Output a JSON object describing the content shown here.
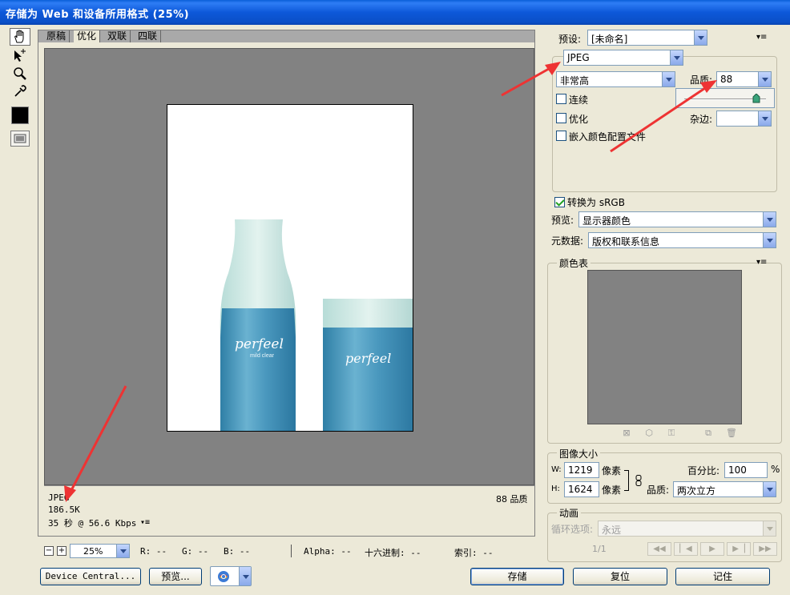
{
  "window": {
    "title": "存储为 Web 和设备所用格式 (25%)"
  },
  "tools": {
    "items": [
      {
        "name": "hand-icon"
      },
      {
        "name": "slice-select-icon"
      },
      {
        "name": "zoom-icon"
      },
      {
        "name": "eyedropper-icon"
      }
    ],
    "eyedropper_color": "#000000"
  },
  "tabs": [
    {
      "label": "原稿",
      "active": false
    },
    {
      "label": "优化",
      "active": true
    },
    {
      "label": "双联",
      "active": false
    },
    {
      "label": "四联",
      "active": false
    }
  ],
  "image": {
    "product_name": "perfeel",
    "product_tagline": "mild clear"
  },
  "info": {
    "format": "JPEG",
    "size": "186.5K",
    "time": "35 秒 @ 56.6 Kbps",
    "quality": "88 品质"
  },
  "statusbar": {
    "zoom": "25%",
    "r": "R: --",
    "g": "G: --",
    "b": "B: --",
    "alpha": "Alpha: --",
    "hex": "十六进制: --",
    "index": "索引: --"
  },
  "bottom_buttons": {
    "device_central": "Device Central...",
    "preview": "预览...",
    "save": "存储",
    "reset": "复位",
    "remember": "记住"
  },
  "settings": {
    "preset_label": "预设:",
    "preset_value": "[未命名]",
    "format_value": "JPEG",
    "quality_preset": "非常高",
    "quality_label": "品质:",
    "quality_value": "88",
    "quality_slider_percent": 88,
    "progressive_label": "连续",
    "progressive": false,
    "optimized_label": "优化",
    "optimized": false,
    "blur_label": "杂边:",
    "blur_value": "",
    "embed_profile_label": "嵌入颜色配置文件",
    "embed_profile": false,
    "convert_srgb_label": "转换为 sRGB",
    "convert_srgb": true,
    "preview_label": "预览:",
    "preview_value": "显示器颜色",
    "metadata_label": "元数据:",
    "metadata_value": "版权和联系信息"
  },
  "color_table": {
    "title": "颜色表"
  },
  "image_size": {
    "title": "图像大小",
    "w_label": "W:",
    "w_value": "1219",
    "w_unit": "像素",
    "h_label": "H:",
    "h_value": "1624",
    "h_unit": "像素",
    "percent_label": "百分比:",
    "percent_value": "100",
    "percent_unit": "%",
    "quality_label": "品质:",
    "quality_value": "两次立方"
  },
  "animation": {
    "title": "动画",
    "loop_label": "循环选项:",
    "loop_value": "永远",
    "frame_counter": "1/1"
  },
  "colors": {
    "annotation_arrow": "#ee3333",
    "canvas_bg": "#828282",
    "title_bar": "#0a5fd8"
  }
}
